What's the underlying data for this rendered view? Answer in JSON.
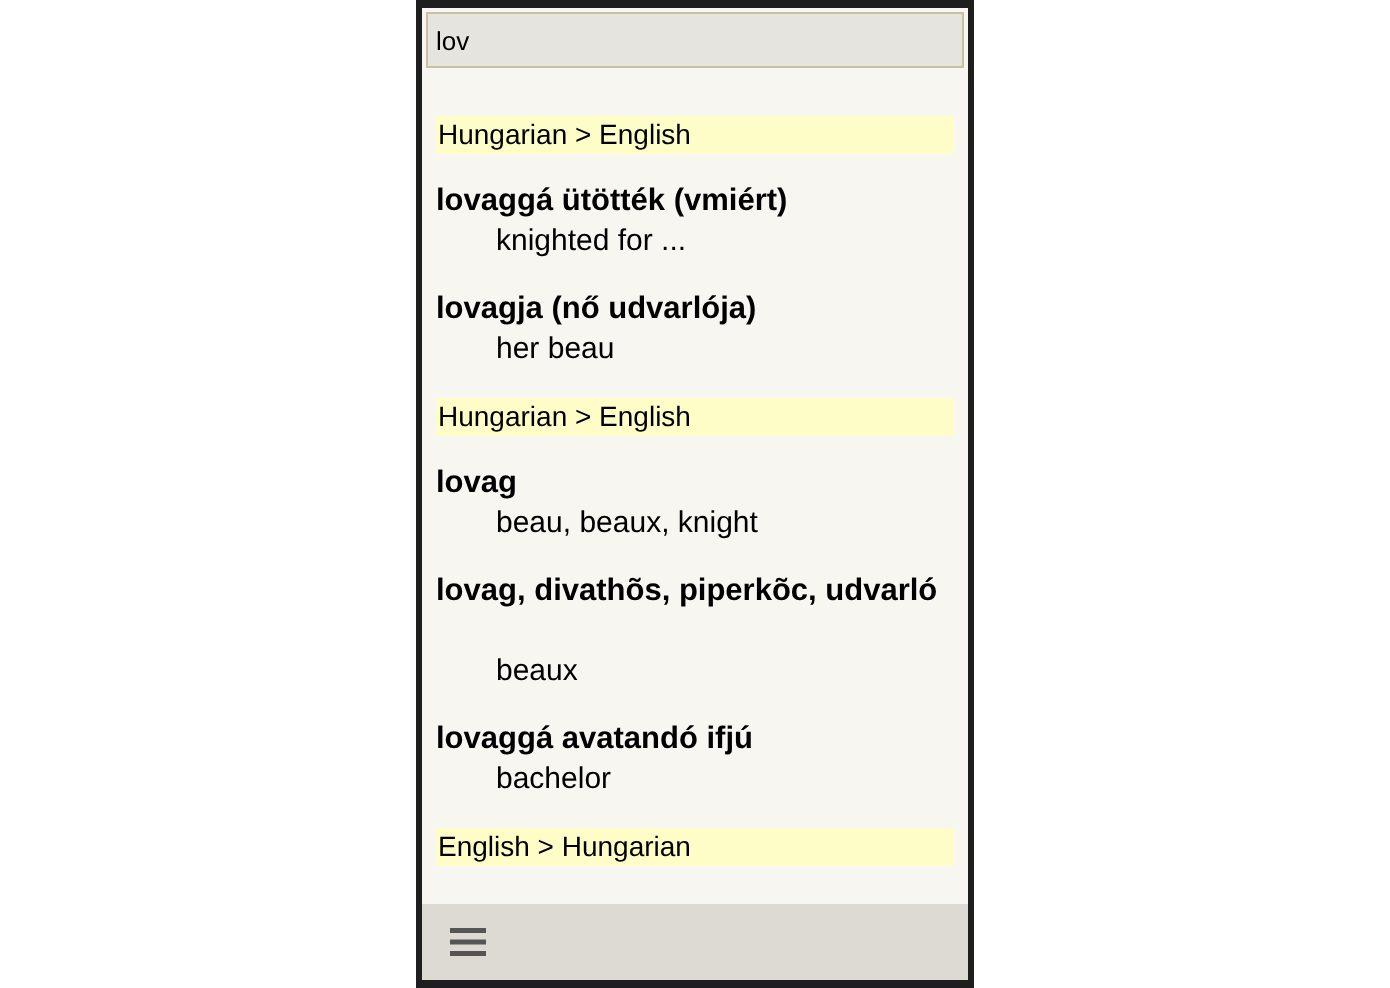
{
  "search": {
    "value": "lov"
  },
  "results": [
    {
      "kind": "header",
      "text": "Hungarian > English"
    },
    {
      "kind": "entry",
      "headword": "lovaggá ütötték (vmiért)",
      "translation": "knighted for ...",
      "blank_line": false
    },
    {
      "kind": "entry",
      "headword": "lovagja (nő udvarlója)",
      "translation": "her beau",
      "blank_line": false
    },
    {
      "kind": "header",
      "text": "Hungarian > English"
    },
    {
      "kind": "entry",
      "headword": "lovag",
      "translation": "beau, beaux, knight",
      "blank_line": false
    },
    {
      "kind": "entry",
      "headword": "lovag, divathõs, piperkõc, udvarló",
      "translation": "beaux",
      "blank_line": true
    },
    {
      "kind": "entry",
      "headword": "lovaggá avatandó ifjú",
      "translation": "bachelor",
      "blank_line": false
    },
    {
      "kind": "header",
      "text": "English > Hungarian"
    }
  ]
}
